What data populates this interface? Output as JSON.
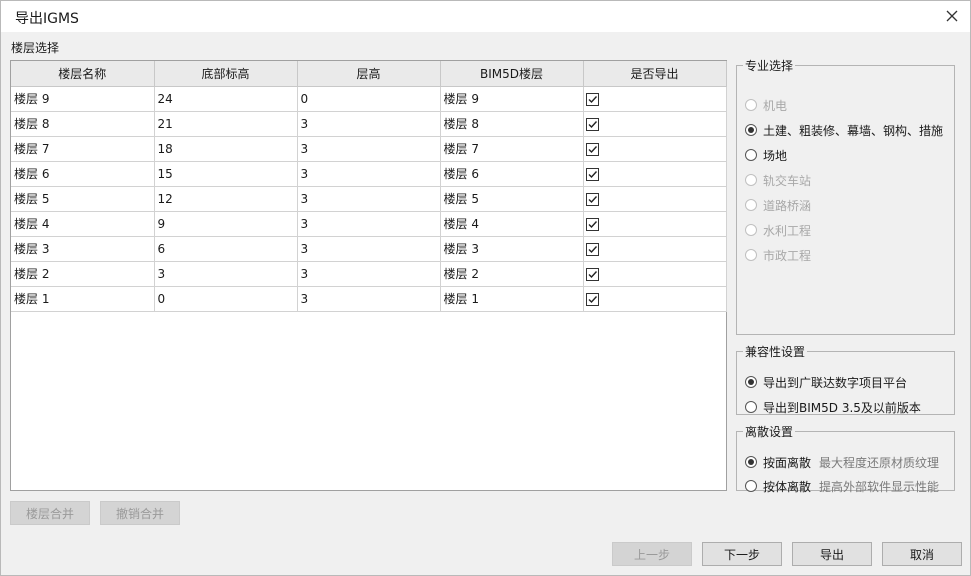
{
  "window": {
    "title": "导出IGMS"
  },
  "floor_section": {
    "label": "楼层选择"
  },
  "table": {
    "columns": [
      "楼层名称",
      "底部标高",
      "层高",
      "BIM5D楼层",
      "是否导出"
    ],
    "rows": [
      {
        "name": "楼层 9",
        "elevation": "24",
        "height": "0",
        "bim5d": "楼层 9",
        "export": true
      },
      {
        "name": "楼层 8",
        "elevation": "21",
        "height": "3",
        "bim5d": "楼层 8",
        "export": true
      },
      {
        "name": "楼层 7",
        "elevation": "18",
        "height": "3",
        "bim5d": "楼层 7",
        "export": true
      },
      {
        "name": "楼层 6",
        "elevation": "15",
        "height": "3",
        "bim5d": "楼层 6",
        "export": true
      },
      {
        "name": "楼层 5",
        "elevation": "12",
        "height": "3",
        "bim5d": "楼层 5",
        "export": true
      },
      {
        "name": "楼层 4",
        "elevation": "9",
        "height": "3",
        "bim5d": "楼层 4",
        "export": true
      },
      {
        "name": "楼层 3",
        "elevation": "6",
        "height": "3",
        "bim5d": "楼层 3",
        "export": true
      },
      {
        "name": "楼层 2",
        "elevation": "3",
        "height": "3",
        "bim5d": "楼层 2",
        "export": true
      },
      {
        "name": "楼层 1",
        "elevation": "0",
        "height": "3",
        "bim5d": "楼层 1",
        "export": true
      }
    ]
  },
  "discipline": {
    "label": "专业选择",
    "options": [
      {
        "label": "机电",
        "enabled": false,
        "selected": false
      },
      {
        "label": "土建、粗装修、幕墙、钢构、措施",
        "enabled": true,
        "selected": true
      },
      {
        "label": "场地",
        "enabled": true,
        "selected": false
      },
      {
        "label": "轨交车站",
        "enabled": false,
        "selected": false
      },
      {
        "label": "道路桥涵",
        "enabled": false,
        "selected": false
      },
      {
        "label": "水利工程",
        "enabled": false,
        "selected": false
      },
      {
        "label": "市政工程",
        "enabled": false,
        "selected": false
      }
    ]
  },
  "compat": {
    "label": "兼容性设置",
    "options": [
      {
        "label": "导出到广联达数字项目平台",
        "selected": true
      },
      {
        "label": "导出到BIM5D 3.5及以前版本",
        "selected": false
      }
    ]
  },
  "discrete": {
    "label": "离散设置",
    "options": [
      {
        "label": "按面离散",
        "hint": "最大程度还原材质纹理",
        "selected": true
      },
      {
        "label": "按体离散",
        "hint": "提高外部软件显示性能",
        "selected": false
      }
    ]
  },
  "buttons": {
    "merge": "楼层合并",
    "unmerge": "撤销合并",
    "prev": "上一步",
    "next": "下一步",
    "export": "导出",
    "cancel": "取消"
  }
}
